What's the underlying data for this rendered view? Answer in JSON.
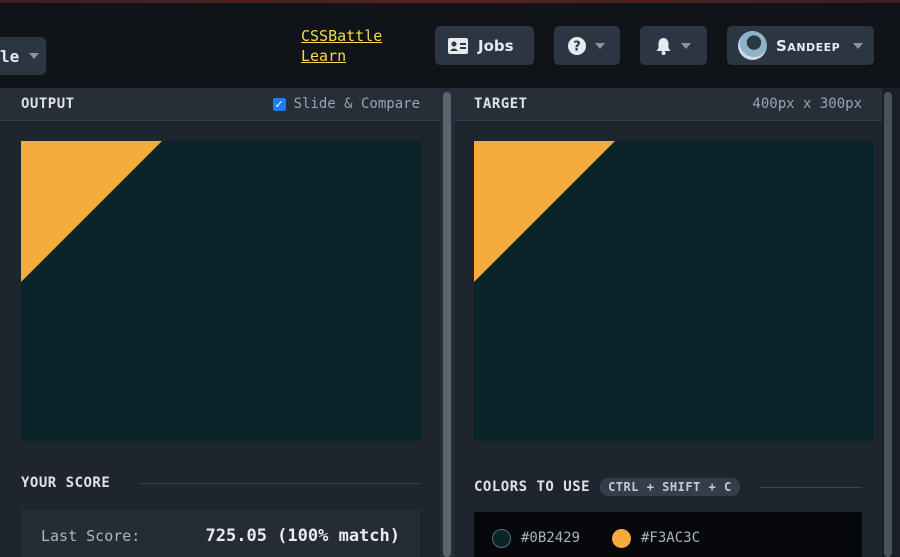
{
  "header": {
    "left_pill_text": "le",
    "links": [
      "CSSBattle",
      "Learn"
    ],
    "jobs_label": "Jobs",
    "user_name": "Sandeep"
  },
  "output": {
    "title": "OUTPUT",
    "compare_label": "Slide & Compare",
    "compare_checked": true
  },
  "target": {
    "title": "TARGET",
    "size_label": "400px x 300px"
  },
  "score": {
    "title": "YOUR SCORE",
    "last_label": "Last Score:",
    "last_value": "725.05 (100% match)"
  },
  "colors": {
    "title": "COLORS TO USE",
    "shortcut": "CTRL + SHIFT + C",
    "items": [
      {
        "hex": "#0B2429",
        "color": "#0B2429"
      },
      {
        "hex": "#F3AC3C",
        "color": "#F3AC3C"
      }
    ]
  },
  "canvas": {
    "background": "#0B2429",
    "shape_color": "#F3AC3C"
  },
  "icons": [
    "chevron-down-icon",
    "id-card-icon",
    "help-circle-icon",
    "bell-icon",
    "avatar",
    "checkbox-icon"
  ]
}
